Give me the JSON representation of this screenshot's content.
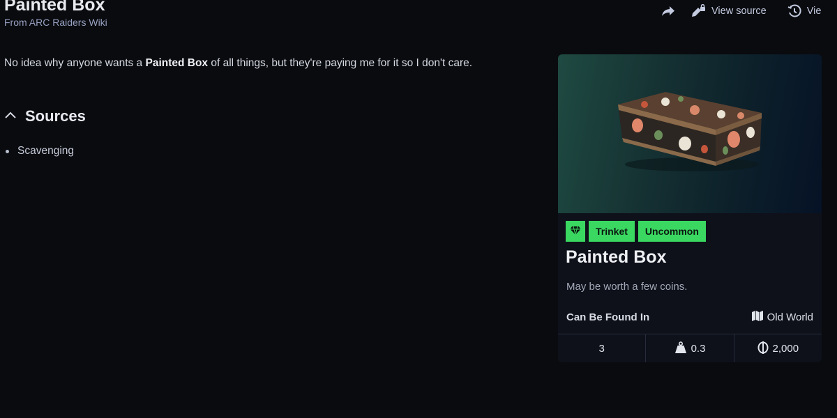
{
  "header": {
    "title": "Painted Box",
    "subtitle": "From ARC Raiders Wiki",
    "toolbar": {
      "share_icon": "share-arrow-icon",
      "view_source_label": "View source",
      "view_source_icon": "pencil-lock-icon",
      "history_label": "Vie",
      "history_icon": "history-clock-icon"
    }
  },
  "intro": {
    "before": "No idea why anyone wants a ",
    "bold": "Painted Box",
    "after": " of all things, but they're paying me for it so I don't care."
  },
  "sources": {
    "heading": "Sources",
    "toggle_icon": "chevron-up-icon",
    "items": [
      "Scavenging"
    ]
  },
  "infobox": {
    "image_alt": "painted-box-image",
    "tags": {
      "rarity_icon": "gem-icon",
      "type": "Trinket",
      "rarity": "Uncommon"
    },
    "title": "Painted Box",
    "description": "May be worth a few coins.",
    "found_in_label": "Can Be Found In",
    "found_in_value": "Old World",
    "found_in_icon": "map-book-icon",
    "stats": {
      "stack": "3",
      "weight": "0.3",
      "weight_icon": "weight-icon",
      "value": "2,000",
      "value_icon": "coin-icon"
    },
    "colors": {
      "tag_bg": "#3ad861",
      "card_bg": "#0e111a"
    }
  }
}
